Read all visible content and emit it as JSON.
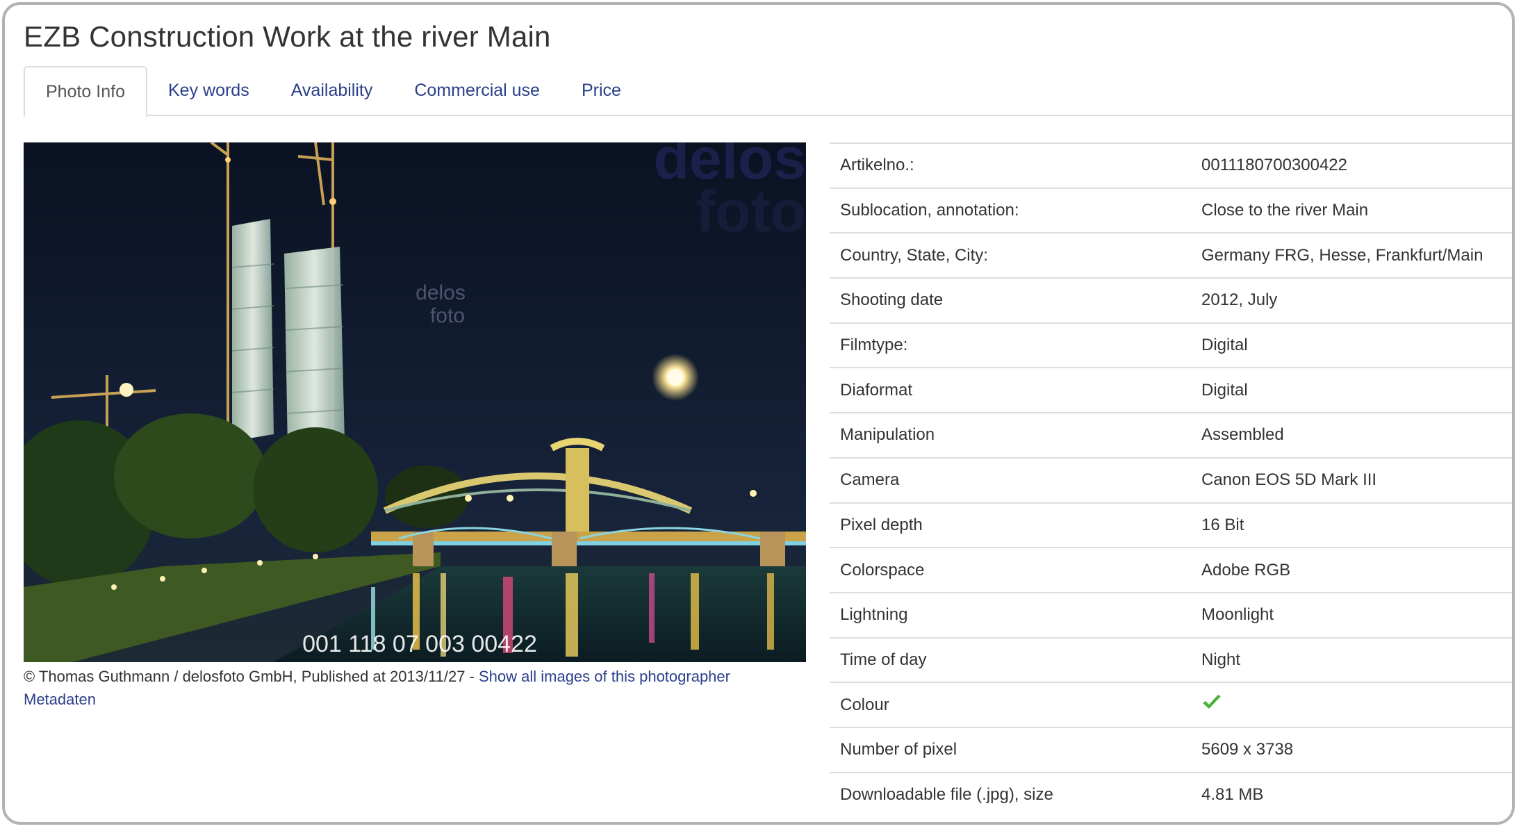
{
  "page": {
    "title": "EZB Construction Work at the river Main"
  },
  "tabs": [
    {
      "label": "Photo Info",
      "active": true
    },
    {
      "label": "Key words",
      "active": false
    },
    {
      "label": "Availability",
      "active": false
    },
    {
      "label": "Commercial use",
      "active": false
    },
    {
      "label": "Price",
      "active": false
    }
  ],
  "photo": {
    "watermark_large_1": "delos",
    "watermark_large_2": "foto",
    "watermark_mid_1": "delos",
    "watermark_mid_2": "foto",
    "image_number": "001 118 07 003 00422"
  },
  "caption": {
    "credit": "© Thomas Guthmann / delosfoto GmbH, Published at 2013/11/27 - ",
    "photographer_link": "Show all images of this photographer",
    "metadata_link": "Metadaten"
  },
  "info_rows": [
    {
      "key": "Artikelno.:",
      "value": "0011180700300422"
    },
    {
      "key": "Sublocation, annotation:",
      "value": "Close to the river Main"
    },
    {
      "key": "Country, State, City:",
      "value": "Germany FRG, Hesse, Frankfurt/Main"
    },
    {
      "key": "Shooting date",
      "value": "2012, July"
    },
    {
      "key": "Filmtype:",
      "value": "Digital"
    },
    {
      "key": "Diaformat",
      "value": "Digital"
    },
    {
      "key": "Manipulation",
      "value": "Assembled"
    },
    {
      "key": "Camera",
      "value": "Canon EOS 5D Mark III"
    },
    {
      "key": "Pixel depth",
      "value": "16 Bit"
    },
    {
      "key": "Colorspace",
      "value": "Adobe RGB"
    },
    {
      "key": "Lightning",
      "value": "Moonlight"
    },
    {
      "key": "Time of day",
      "value": "Night"
    },
    {
      "key": "Colour",
      "value": "",
      "icon": "checkmark-icon"
    },
    {
      "key": "Number of pixel",
      "value": "5609 x 3738"
    },
    {
      "key": "Downloadable file (.jpg), size",
      "value": "4.81 MB"
    }
  ],
  "colors": {
    "link": "#2a3f8a",
    "check": "#4caf3a",
    "border": "#dddddd"
  }
}
